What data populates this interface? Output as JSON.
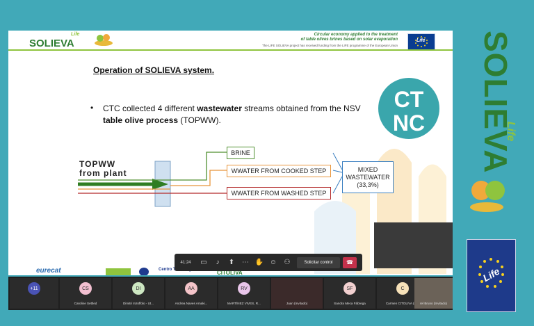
{
  "slide": {
    "logo_text": "SOLIEVA",
    "logo_life": "Life",
    "header_line1": "Circular economy applied to the treatment",
    "header_line2": "of table olives brines based on solar evaporation",
    "header_line3": "The LIFE SOLIEVA project has received funding from the LIFE programme of the European Union",
    "eu_life": "Life",
    "title": "Operation of SOLIEVA system.",
    "bullet_prefix": "CTC collected 4 different ",
    "bullet_b1": "wastewater",
    "bullet_mid": " streams obtained from the NSV ",
    "bullet_b2": "table olive process",
    "bullet_suffix": " (TOPWW).",
    "ctnc": "CTNC",
    "topww_label_1": "TOPWW",
    "topww_label_2": "from plant",
    "stream_brine": "BRINE",
    "stream_cooked": "WWATER FROM COOKED STEP",
    "stream_washed": "WWATER FROM WASHED STEP",
    "mixed_1": "MIXED",
    "mixed_2": "WASTEWATER",
    "mixed_3": "(33,3%)",
    "sponsor_eurecat": "eurecat",
    "sponsor_citolva": "CITOLIVA",
    "sponsor_centro": "Centro Tecnológico",
    "colors": {
      "brine": "#4f8f2f",
      "cooked": "#e8953a",
      "washed": "#b3292a",
      "arrow": "#2f7d22"
    }
  },
  "meeting": {
    "time": "41:24",
    "control_label": "Solicitar control",
    "icons": [
      "camera-off-icon",
      "mic-off-icon",
      "share-icon",
      "more-icon",
      "hand-icon",
      "reactions-icon",
      "participants-icon",
      "hangup-icon"
    ]
  },
  "participants": [
    {
      "initials": "+11",
      "name": "",
      "color": "#4a53b5"
    },
    {
      "initials": "CS",
      "name": "Caroline Settled",
      "color": "#f2bfd0"
    },
    {
      "initials": "DI",
      "name": "Dimitri Inzoffolo - Ut...",
      "color": "#cde7c2"
    },
    {
      "initials": "AA",
      "name": "Andrea Naves Amaki...",
      "color": "#f4c4c9"
    },
    {
      "initials": "RV",
      "name": "MARTÍNEZ VIVES, R...",
      "color": "#e9c6ea"
    },
    {
      "initials": "",
      "name": "Juan (Invitado)",
      "color": "#3b2a2a"
    },
    {
      "initials": "SF",
      "name": "Sandra Meca Fábrega",
      "color": "#f2d0d0"
    },
    {
      "initials": "C",
      "name": "Carmen CITOLIVA (In...",
      "color": "#f7e2b9"
    },
    {
      "initials": "",
      "name": "rel Bruno (Invitado)",
      "color": "#6b6258"
    }
  ],
  "side": {
    "brand": "SOLIEVA",
    "life": "Life",
    "eu_life": "Life"
  }
}
